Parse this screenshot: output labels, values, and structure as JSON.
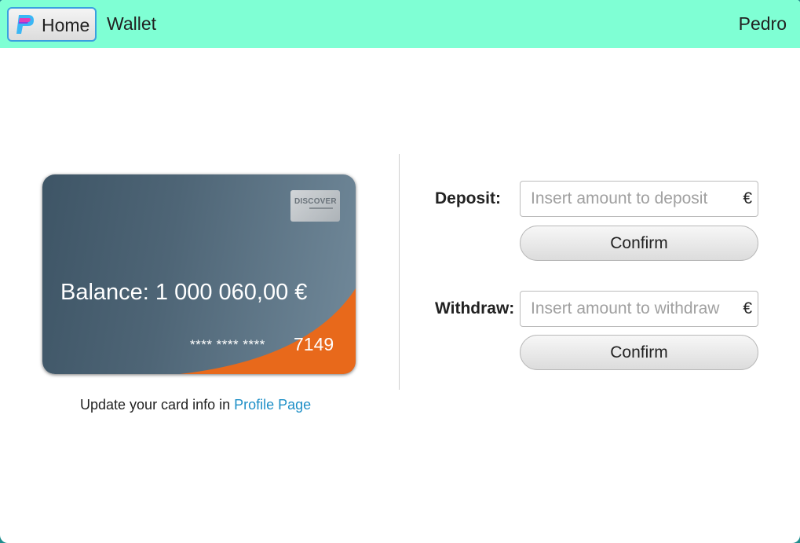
{
  "header": {
    "home_label": "Home",
    "wallet_label": "Wallet",
    "user_name": "Pedro"
  },
  "card": {
    "brand_text": "DISCOVER",
    "balance_text": "Balance: 1 000 060,00 €",
    "masked_digits": "**** **** ****",
    "last_digits": "7149"
  },
  "update_info": {
    "prefix": "Update your card info in",
    "link_text": "Profile Page"
  },
  "deposit": {
    "label": "Deposit:",
    "placeholder": "Insert amount to deposit",
    "currency": "€",
    "confirm_label": "Confirm"
  },
  "withdraw": {
    "label": "Withdraw:",
    "placeholder": "Insert amount to withdraw",
    "currency": "€",
    "confirm_label": "Confirm"
  },
  "colors": {
    "header_bg": "#7fffd4",
    "link": "#1e8fc7",
    "card_accent": "#e8691b",
    "card_base": "#3e5566"
  }
}
